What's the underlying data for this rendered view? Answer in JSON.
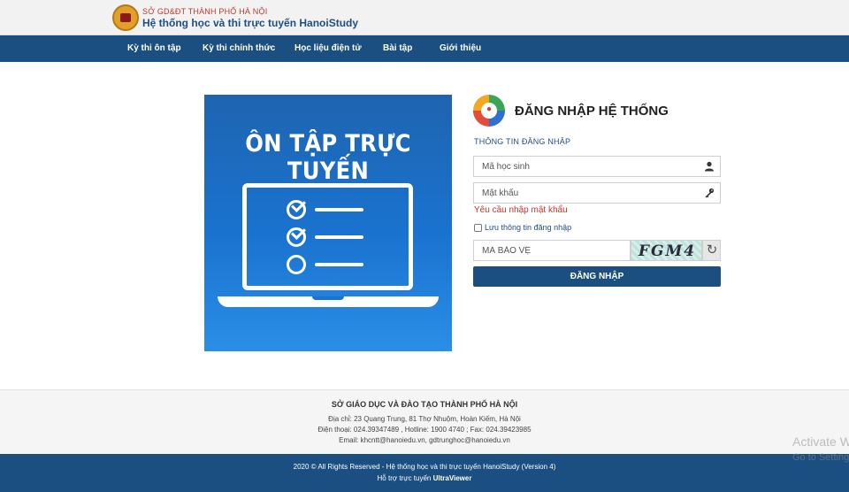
{
  "header": {
    "org_name": "SỞ GD&ĐT THÀNH PHỐ HÀ NỘI",
    "site_name": "Hệ thống học và thi trực tuyến HanoiStudy",
    "logo_icon": "hanoi-education-logo"
  },
  "nav": {
    "items": [
      {
        "label": "Kỳ thi ôn tập"
      },
      {
        "label": "Kỳ thi chính thức"
      },
      {
        "label": "Học liệu điện tử"
      },
      {
        "label": "Bài tập"
      },
      {
        "label": "Giới thiệu"
      }
    ]
  },
  "banner": {
    "title": "ÔN TẬP TRỰC TUYẾN",
    "icon": "laptop-checklist-icon"
  },
  "login": {
    "title": "ĐĂNG NHẬP HỆ THỐNG",
    "section_label": "THÔNG TIN ĐĂNG NHẬP",
    "username_placeholder": "Mã học sinh",
    "password_placeholder": "Mật khẩu",
    "password_error": "Yêu cầu nhập mật khẩu",
    "remember_label": "Lưu thông tin đăng nhập",
    "remember_checked": false,
    "captcha_placeholder": "MÃ BẢO VỆ",
    "captcha_image_text": "FGM4",
    "submit_label": "ĐĂNG NHẬP",
    "icons": {
      "user": "user-icon",
      "password": "key-icon",
      "refresh": "refresh-icon",
      "brand": "lock-icon"
    }
  },
  "footer": {
    "org": "SỞ GIÁO DỤC VÀ ĐÀO TẠO THÀNH PHỐ HÀ NỘI",
    "address": "Địa chỉ: 23 Quang Trung, 81 Thợ Nhuộm, Hoàn Kiếm, Hà Nội",
    "phone": "Điện thoại: 024.39347489 , Hotline: 1900 4740 ; Fax: 024.39423985",
    "email": "Email: khcntt@hanoiedu.vn, gdtrunghoc@hanoiedu.vn",
    "copyright": "2020 © All Rights Reserved - Hệ thống học và thi trực tuyến HanoiStudy (Version 4)",
    "support_prefix": "Hỗ trợ trực tuyến",
    "support_link": "UltraViewer"
  },
  "watermark": {
    "line1": "Activate W",
    "line2": "Go to Setting"
  },
  "colors": {
    "primary": "#1b4f82",
    "error": "#d0302a",
    "accent_red": "#c0392b"
  }
}
